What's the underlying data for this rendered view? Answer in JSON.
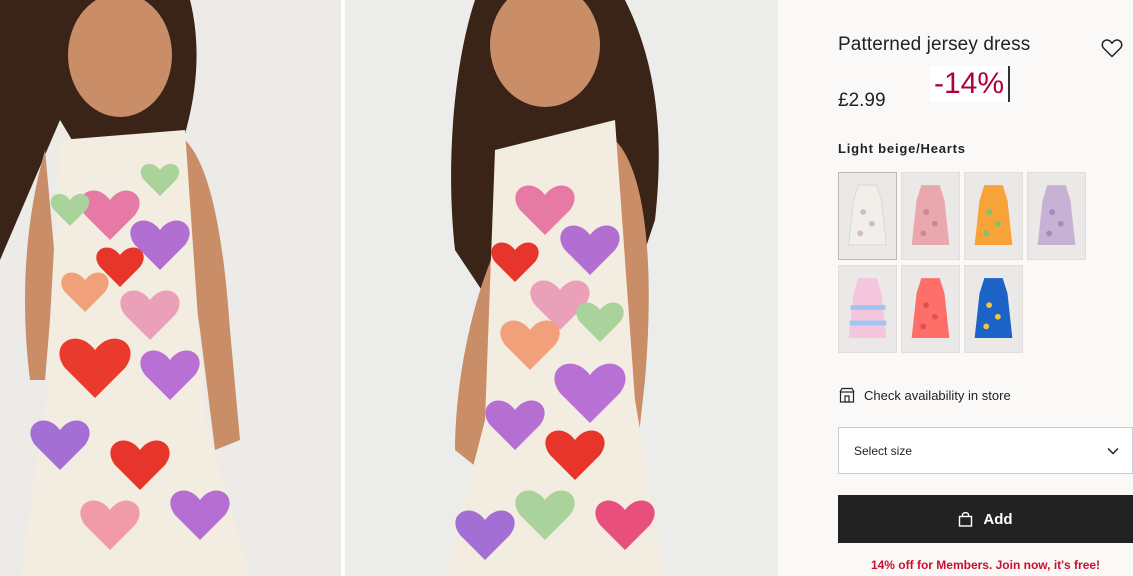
{
  "product": {
    "title": "Patterned jersey dress",
    "price": "£2.99",
    "discount_badge": "-14%",
    "color_name": "Light beige/Hearts",
    "favorite_icon": "heart-outline-icon"
  },
  "swatches": [
    {
      "name": "Light beige/Hearts",
      "color": "#f1efe9",
      "pattern": "#d9b8c6"
    },
    {
      "name": "Pink",
      "color": "#eaa7ae",
      "pattern": "#c98892"
    },
    {
      "name": "Orange fruit",
      "color": "#f7a33a",
      "pattern": "#7cc56a"
    },
    {
      "name": "Lilac",
      "color": "#c7b2d6",
      "pattern": "#a48bbd"
    },
    {
      "name": "Tie-dye",
      "color": "#f4c6de",
      "pattern": "#9fc6f0"
    },
    {
      "name": "Coral",
      "color": "#ff6f6a",
      "pattern": "#e0504d"
    },
    {
      "name": "Blue",
      "color": "#1c63c8",
      "pattern": "#f4c33c"
    }
  ],
  "store": {
    "label": "Check availability in store",
    "icon": "store-icon"
  },
  "size": {
    "label": "Select size",
    "icon": "chevron-down-icon"
  },
  "cart": {
    "label": "Add",
    "icon": "shopping-bag-icon"
  },
  "member": {
    "label": "14% off for Members. Join now, it's free!"
  },
  "colors": {
    "brand_red": "#c8102e",
    "discount_red": "#b0003a",
    "button_dark": "#222222"
  }
}
